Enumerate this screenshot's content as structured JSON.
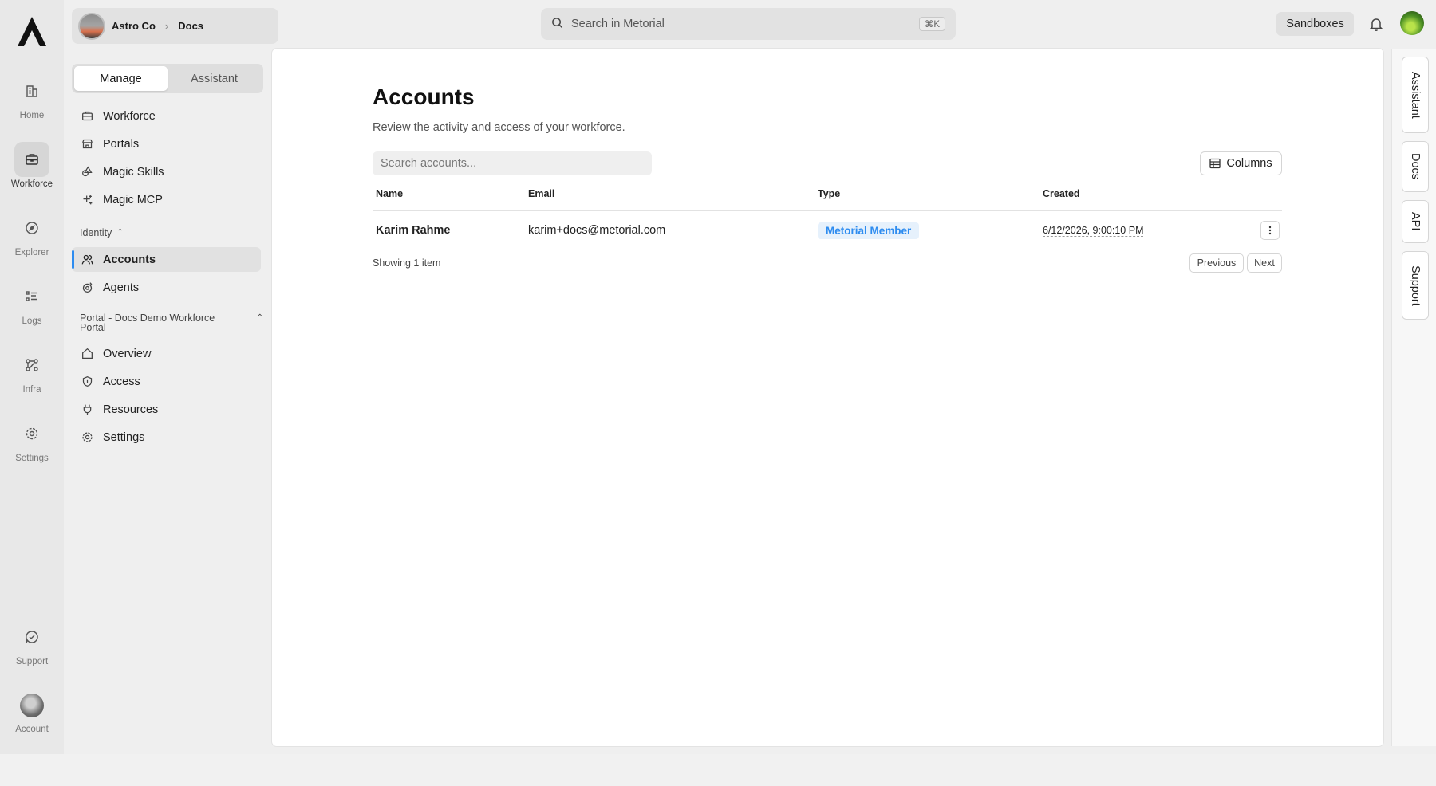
{
  "rail": {
    "items": [
      {
        "label": "Home",
        "icon": "building-icon"
      },
      {
        "label": "Workforce",
        "icon": "briefcase-icon"
      },
      {
        "label": "Explorer",
        "icon": "compass-icon"
      },
      {
        "label": "Logs",
        "icon": "list-icon"
      },
      {
        "label": "Infra",
        "icon": "nodes-icon"
      },
      {
        "label": "Settings",
        "icon": "gear-icon"
      },
      {
        "label": "Support",
        "icon": "chat-icon"
      },
      {
        "label": "Account",
        "icon": "avatar"
      }
    ],
    "active": "Workforce"
  },
  "workspace": {
    "org": "Astro Co",
    "section": "Docs"
  },
  "mode_tabs": {
    "manage": "Manage",
    "assistant": "Assistant",
    "active": "Manage"
  },
  "sidebar": {
    "main_items": [
      {
        "label": "Workforce",
        "icon": "briefcase-icon"
      },
      {
        "label": "Portals",
        "icon": "store-icon"
      },
      {
        "label": "Magic Skills",
        "icon": "shapes-icon"
      },
      {
        "label": "Magic MCP",
        "icon": "sparkles-icon"
      }
    ],
    "identity_label": "Identity",
    "identity_items": [
      {
        "label": "Accounts",
        "icon": "users-icon"
      },
      {
        "label": "Agents",
        "icon": "bot-icon"
      }
    ],
    "portal_label": "Portal - Docs Demo Workforce Portal",
    "portal_items": [
      {
        "label": "Overview",
        "icon": "home-icon"
      },
      {
        "label": "Access",
        "icon": "shield-icon"
      },
      {
        "label": "Resources",
        "icon": "plug-icon"
      },
      {
        "label": "Settings",
        "icon": "gear-icon"
      }
    ],
    "active": "Accounts"
  },
  "topbar": {
    "search_placeholder": "Search in Metorial",
    "shortcut": "⌘K",
    "sandboxes": "Sandboxes"
  },
  "page": {
    "title": "Accounts",
    "subtitle": "Review the activity and access of your workforce.",
    "search_placeholder": "Search accounts...",
    "columns_button": "Columns",
    "headers": {
      "name": "Name",
      "email": "Email",
      "type": "Type",
      "created": "Created"
    },
    "rows": [
      {
        "name": "Karim Rahme",
        "email": "karim+docs@metorial.com",
        "type": "Metorial Member",
        "created": "6/12/2026, 9:00:10 PM"
      }
    ],
    "showing": "Showing 1 item",
    "prev": "Previous",
    "next": "Next"
  },
  "dock": {
    "tabs": [
      "Assistant",
      "Docs",
      "API",
      "Support"
    ]
  },
  "colors": {
    "accent": "#2d8cf0",
    "badge_bg": "#e6f1fc"
  }
}
